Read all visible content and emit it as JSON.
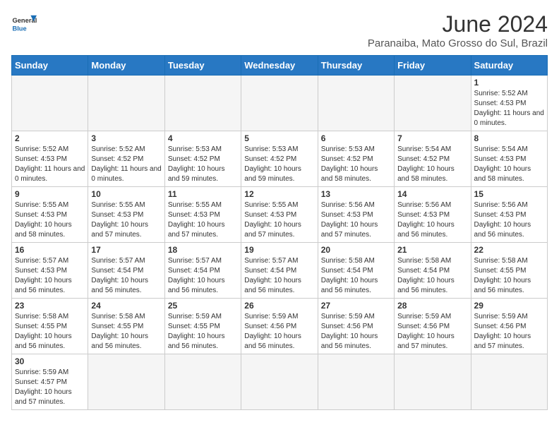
{
  "header": {
    "logo_general": "General",
    "logo_blue": "Blue",
    "month_year": "June 2024",
    "location": "Paranaiba, Mato Grosso do Sul, Brazil"
  },
  "days_of_week": [
    "Sunday",
    "Monday",
    "Tuesday",
    "Wednesday",
    "Thursday",
    "Friday",
    "Saturday"
  ],
  "weeks": [
    [
      {
        "day": "",
        "info": "",
        "empty": true
      },
      {
        "day": "",
        "info": "",
        "empty": true
      },
      {
        "day": "",
        "info": "",
        "empty": true
      },
      {
        "day": "",
        "info": "",
        "empty": true
      },
      {
        "day": "",
        "info": "",
        "empty": true
      },
      {
        "day": "",
        "info": "",
        "empty": true
      },
      {
        "day": "1",
        "info": "Sunrise: 5:52 AM\nSunset: 4:53 PM\nDaylight: 11 hours and 0 minutes."
      }
    ],
    [
      {
        "day": "2",
        "info": "Sunrise: 5:52 AM\nSunset: 4:53 PM\nDaylight: 11 hours and 0 minutes."
      },
      {
        "day": "3",
        "info": "Sunrise: 5:52 AM\nSunset: 4:52 PM\nDaylight: 11 hours and 0 minutes."
      },
      {
        "day": "4",
        "info": "Sunrise: 5:53 AM\nSunset: 4:52 PM\nDaylight: 10 hours and 59 minutes."
      },
      {
        "day": "5",
        "info": "Sunrise: 5:53 AM\nSunset: 4:52 PM\nDaylight: 10 hours and 59 minutes."
      },
      {
        "day": "6",
        "info": "Sunrise: 5:53 AM\nSunset: 4:52 PM\nDaylight: 10 hours and 58 minutes."
      },
      {
        "day": "7",
        "info": "Sunrise: 5:54 AM\nSunset: 4:52 PM\nDaylight: 10 hours and 58 minutes."
      },
      {
        "day": "8",
        "info": "Sunrise: 5:54 AM\nSunset: 4:53 PM\nDaylight: 10 hours and 58 minutes."
      }
    ],
    [
      {
        "day": "9",
        "info": "Sunrise: 5:55 AM\nSunset: 4:53 PM\nDaylight: 10 hours and 58 minutes."
      },
      {
        "day": "10",
        "info": "Sunrise: 5:55 AM\nSunset: 4:53 PM\nDaylight: 10 hours and 57 minutes."
      },
      {
        "day": "11",
        "info": "Sunrise: 5:55 AM\nSunset: 4:53 PM\nDaylight: 10 hours and 57 minutes."
      },
      {
        "day": "12",
        "info": "Sunrise: 5:55 AM\nSunset: 4:53 PM\nDaylight: 10 hours and 57 minutes."
      },
      {
        "day": "13",
        "info": "Sunrise: 5:56 AM\nSunset: 4:53 PM\nDaylight: 10 hours and 57 minutes."
      },
      {
        "day": "14",
        "info": "Sunrise: 5:56 AM\nSunset: 4:53 PM\nDaylight: 10 hours and 56 minutes."
      },
      {
        "day": "15",
        "info": "Sunrise: 5:56 AM\nSunset: 4:53 PM\nDaylight: 10 hours and 56 minutes."
      }
    ],
    [
      {
        "day": "16",
        "info": "Sunrise: 5:57 AM\nSunset: 4:53 PM\nDaylight: 10 hours and 56 minutes."
      },
      {
        "day": "17",
        "info": "Sunrise: 5:57 AM\nSunset: 4:54 PM\nDaylight: 10 hours and 56 minutes."
      },
      {
        "day": "18",
        "info": "Sunrise: 5:57 AM\nSunset: 4:54 PM\nDaylight: 10 hours and 56 minutes."
      },
      {
        "day": "19",
        "info": "Sunrise: 5:57 AM\nSunset: 4:54 PM\nDaylight: 10 hours and 56 minutes."
      },
      {
        "day": "20",
        "info": "Sunrise: 5:58 AM\nSunset: 4:54 PM\nDaylight: 10 hours and 56 minutes."
      },
      {
        "day": "21",
        "info": "Sunrise: 5:58 AM\nSunset: 4:54 PM\nDaylight: 10 hours and 56 minutes."
      },
      {
        "day": "22",
        "info": "Sunrise: 5:58 AM\nSunset: 4:55 PM\nDaylight: 10 hours and 56 minutes."
      }
    ],
    [
      {
        "day": "23",
        "info": "Sunrise: 5:58 AM\nSunset: 4:55 PM\nDaylight: 10 hours and 56 minutes."
      },
      {
        "day": "24",
        "info": "Sunrise: 5:58 AM\nSunset: 4:55 PM\nDaylight: 10 hours and 56 minutes."
      },
      {
        "day": "25",
        "info": "Sunrise: 5:59 AM\nSunset: 4:55 PM\nDaylight: 10 hours and 56 minutes."
      },
      {
        "day": "26",
        "info": "Sunrise: 5:59 AM\nSunset: 4:56 PM\nDaylight: 10 hours and 56 minutes."
      },
      {
        "day": "27",
        "info": "Sunrise: 5:59 AM\nSunset: 4:56 PM\nDaylight: 10 hours and 56 minutes."
      },
      {
        "day": "28",
        "info": "Sunrise: 5:59 AM\nSunset: 4:56 PM\nDaylight: 10 hours and 57 minutes."
      },
      {
        "day": "29",
        "info": "Sunrise: 5:59 AM\nSunset: 4:56 PM\nDaylight: 10 hours and 57 minutes."
      }
    ],
    [
      {
        "day": "30",
        "info": "Sunrise: 5:59 AM\nSunset: 4:57 PM\nDaylight: 10 hours and 57 minutes."
      },
      {
        "day": "",
        "info": "",
        "empty": true
      },
      {
        "day": "",
        "info": "",
        "empty": true
      },
      {
        "day": "",
        "info": "",
        "empty": true
      },
      {
        "day": "",
        "info": "",
        "empty": true
      },
      {
        "day": "",
        "info": "",
        "empty": true
      },
      {
        "day": "",
        "info": "",
        "empty": true
      }
    ]
  ]
}
